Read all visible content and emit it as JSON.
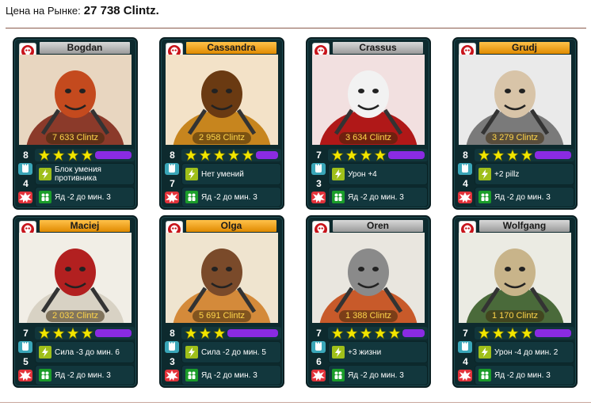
{
  "header": {
    "label": "Цена на Рынке:",
    "value": "27 738 Clintz."
  },
  "colors": {
    "card_bg": "#0d2a2e",
    "star": "#f2e600",
    "purple_bar": "#8a2be2",
    "price_text": "#ffd54a",
    "power_icon": "#3aa6b8",
    "damage_icon": "#e2323a",
    "ability_icon": "#9fbf1a",
    "bonus_icon": "#1b9d2a"
  },
  "cards": [
    {
      "name": "Bogdan",
      "name_color": "grey",
      "price": "7 633 Clintz",
      "power": "8",
      "damage": "4",
      "stars": 4,
      "ability": "Блок умения противника",
      "bonus": "Яд -2 до мин. 3",
      "icon": "clan-skull-icon",
      "portrait": "bogdan-portrait"
    },
    {
      "name": "Cassandra",
      "name_color": "orange",
      "price": "2 958 Clintz",
      "power": "8",
      "damage": "7",
      "stars": 5,
      "ability": "Нет умений",
      "bonus": "Яд -2 до мин. 3",
      "icon": "clan-skull-icon",
      "portrait": "cassandra-portrait"
    },
    {
      "name": "Crassus",
      "name_color": "grey",
      "price": "3 634 Clintz",
      "power": "7",
      "damage": "3",
      "stars": 4,
      "ability": "Урон +4",
      "bonus": "Яд -2 до мин. 3",
      "icon": "clan-skull-icon",
      "portrait": "crassus-portrait"
    },
    {
      "name": "Grudj",
      "name_color": "orange",
      "price": "3 279 Clintz",
      "power": "8",
      "damage": "4",
      "stars": 4,
      "ability": "+2 pillz",
      "bonus": "Яд -2 до мин. 3",
      "icon": "clan-skull-icon",
      "portrait": "grudj-portrait"
    },
    {
      "name": "Maciej",
      "name_color": "orange",
      "price": "2 032 Clintz",
      "power": "7",
      "damage": "5",
      "stars": 4,
      "ability": "Сила -3 до мин. 6",
      "bonus": "Яд -2 до мин. 3",
      "icon": "clan-skull-icon",
      "portrait": "maciej-portrait"
    },
    {
      "name": "Olga",
      "name_color": "orange",
      "price": "5 691 Clintz",
      "power": "8",
      "damage": "3",
      "stars": 3,
      "ability": "Сила -2 до мин. 5",
      "bonus": "Яд -2 до мин. 3",
      "icon": "clan-skull-icon",
      "portrait": "olga-portrait"
    },
    {
      "name": "Oren",
      "name_color": "grey",
      "price": "1 388 Clintz",
      "power": "7",
      "damage": "6",
      "stars": 5,
      "ability": "+3 жизни",
      "bonus": "Яд -2 до мин. 3",
      "icon": "clan-skull-icon",
      "portrait": "oren-portrait"
    },
    {
      "name": "Wolfgang",
      "name_color": "grey",
      "price": "1 170 Clintz",
      "power": "7",
      "damage": "4",
      "stars": 4,
      "ability": "Урон -4 до мин. 2",
      "bonus": "Яд -2 до мин. 3",
      "icon": "clan-skull-icon",
      "portrait": "wolfgang-portrait"
    }
  ]
}
